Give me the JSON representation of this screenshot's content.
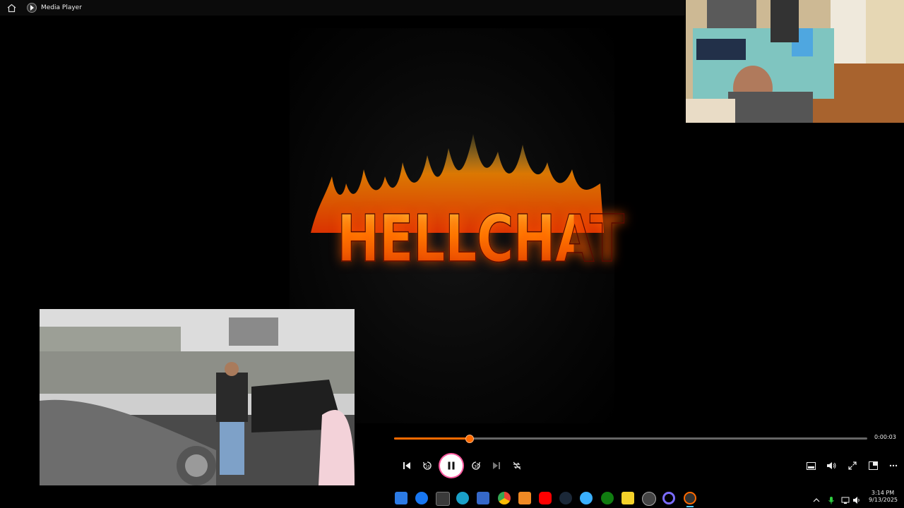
{
  "titlebar": {
    "app_title": "Media Player",
    "home_icon": "home-icon",
    "app_icon": "media-player-icon"
  },
  "logo": {
    "text": "HELLCHAT"
  },
  "player": {
    "elapsed": "0:00:03",
    "progress_fraction": 0.16,
    "controls": [
      "previous-icon",
      "rewind-10-icon",
      "pause-icon",
      "forward-30-icon",
      "next-icon",
      "repeat-off-icon"
    ],
    "right_controls": [
      "miniplayer-icon",
      "volume-icon",
      "fullscreen-icon",
      "cast-icon",
      "more-icon"
    ]
  },
  "taskbar": {
    "apps": [
      "windows-explorer-icon",
      "facebook-icon",
      "amazon-icon",
      "edge-icon",
      "calculator-icon",
      "chrome-icon",
      "vlc-icon",
      "youtube-icon",
      "steam-icon",
      "app-blue-icon",
      "xbox-icon",
      "sticky-notes-icon",
      "obs-icon",
      "cortana-icon",
      "media-player-icon"
    ],
    "tray": [
      "chevron-up-icon",
      "mic-icon",
      "network-icon",
      "speaker-icon"
    ],
    "time": "3:14 PM",
    "date": "9/13/2025"
  },
  "colors": {
    "accent": "#ff6a00",
    "background": "#000000"
  }
}
